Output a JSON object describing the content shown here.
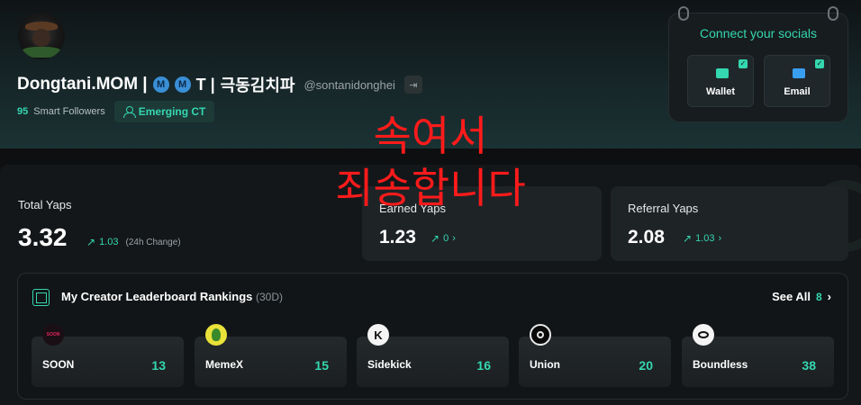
{
  "profile": {
    "display_name": "Dongtani.MOM |",
    "badge_a": "M",
    "badge_b": "M",
    "badge_t": "T |",
    "korean_name": "극동김치파",
    "handle": "@sontanidonghei",
    "smart_followers_count": "95",
    "smart_followers_label": "Smart Followers",
    "tier_badge": "Emerging CT"
  },
  "socials": {
    "title": "Connect your socials",
    "wallet_label": "Wallet",
    "email_label": "Email",
    "colors": {
      "accent": "#34d7b0",
      "email_icon": "#3a9ef0"
    }
  },
  "stats": {
    "total_label": "Total Yaps",
    "total_value": "3.32",
    "total_change": "1.03",
    "total_change_note": "(24h Change)",
    "earned_label": "Earned Yaps",
    "earned_value": "1.23",
    "earned_change": "0",
    "referral_label": "Referral Yaps",
    "referral_value": "2.08",
    "referral_change": "1.03"
  },
  "leaderboard": {
    "title": "My Creator Leaderboard Rankings",
    "period": "(30D)",
    "see_all_label": "See All",
    "see_all_count": "8",
    "projects": [
      {
        "name": "SOON",
        "rank": "13",
        "logo_text": "SOON"
      },
      {
        "name": "MemeX",
        "rank": "15",
        "logo_text": ""
      },
      {
        "name": "Sidekick",
        "rank": "16",
        "logo_text": "K"
      },
      {
        "name": "Union",
        "rank": "20",
        "logo_text": ""
      },
      {
        "name": "Boundless",
        "rank": "38",
        "logo_text": ""
      }
    ]
  },
  "overlay": {
    "line1": "속여서",
    "line2": "죄송합니다"
  }
}
